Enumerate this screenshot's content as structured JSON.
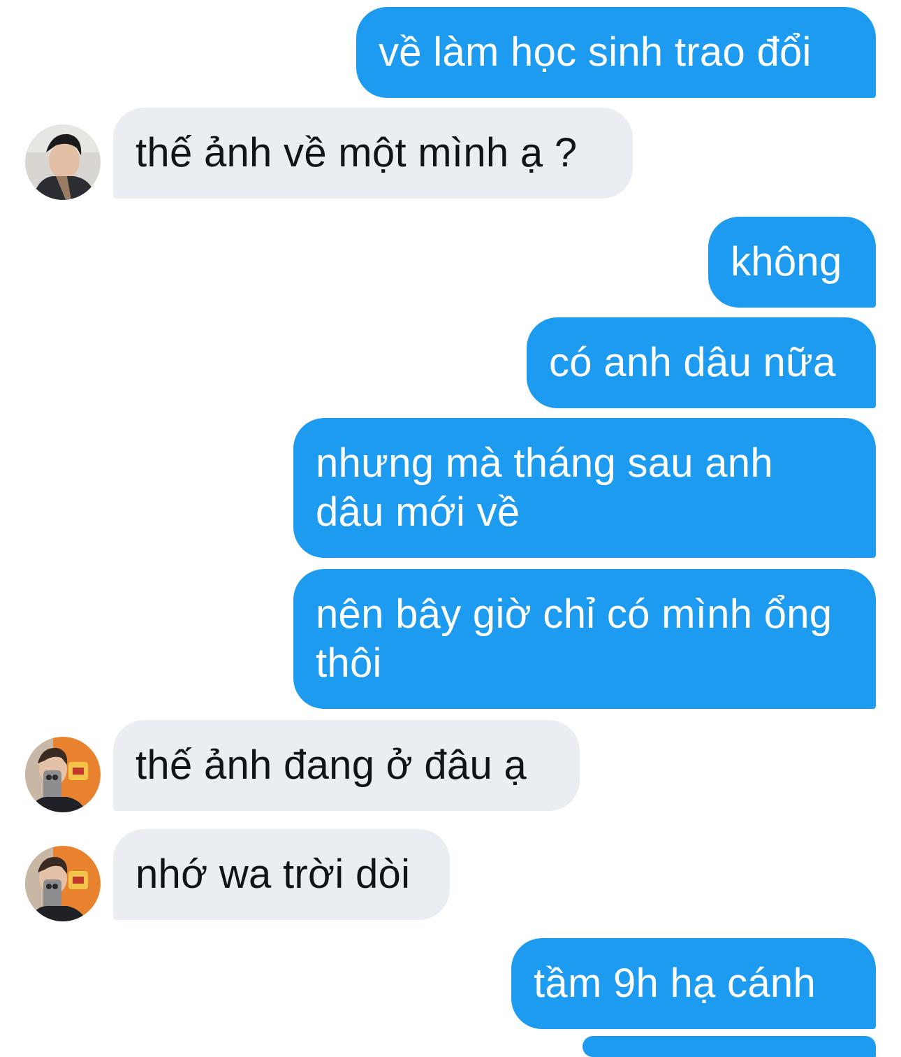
{
  "conversation": {
    "messages": [
      {
        "direction": "outgoing",
        "text": "về làm học sinh trao đổi"
      },
      {
        "direction": "incoming",
        "text": "thế ảnh về một mình ạ ?"
      },
      {
        "direction": "outgoing",
        "text": "không"
      },
      {
        "direction": "outgoing",
        "text": "có anh dâu nữa"
      },
      {
        "direction": "outgoing",
        "text": "nhưng mà tháng sau anh dâu mới về"
      },
      {
        "direction": "outgoing",
        "text": "nên bây giờ chỉ có mình ổng thôi"
      },
      {
        "direction": "incoming",
        "text": "thế ảnh đang ở đâu ạ"
      },
      {
        "direction": "incoming",
        "text": "nhớ wa trời dòi"
      },
      {
        "direction": "outgoing",
        "text": "tầm 9h hạ cánh"
      }
    ]
  },
  "colors": {
    "outgoing_bubble": "#1d9bf0",
    "incoming_bubble": "#eaeef2",
    "background": "#ffffff"
  }
}
